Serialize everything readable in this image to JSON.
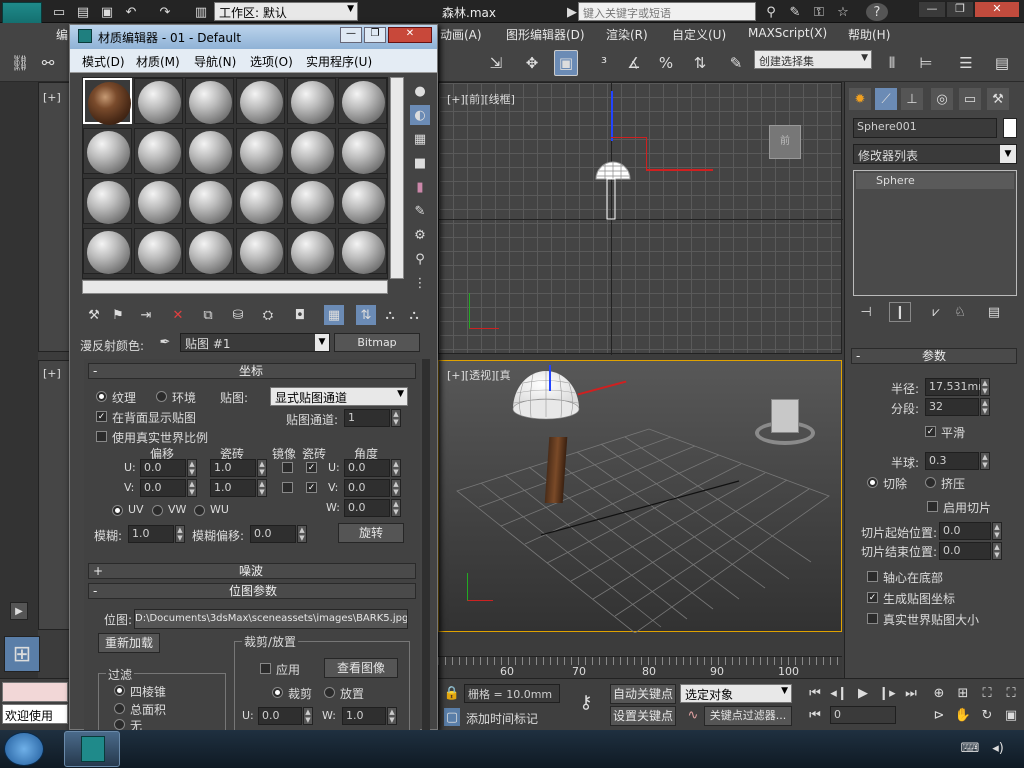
{
  "app": {
    "workspace_label": "工作区: 默认",
    "file_title": "森林.max",
    "search_placeholder": "键入关键字或短语"
  },
  "menu": [
    "编",
    "动画(A)",
    "图形编辑器(D)",
    "渲染(R)",
    "自定义(U)",
    "MAXScript(X)",
    "帮助(H)"
  ],
  "toolbar": {
    "selection_set": "创建选择集"
  },
  "viewports": {
    "front_label": "[+][前][线框]",
    "persp_label": "[+][透视][真",
    "topleft_label": "[+]",
    "midleft_label": "[+]"
  },
  "timeline": {
    "ticks": [
      "60",
      "70",
      "80",
      "90",
      "100"
    ]
  },
  "command_panel": {
    "object_name": "Sphere001",
    "modifier_list": "修改器列表",
    "stack_item": "Sphere",
    "params_title": "参数",
    "radius_label": "半径:",
    "radius_value": "17.531mm",
    "segments_label": "分段:",
    "segments_value": "32",
    "smooth_label": "平滑",
    "hemisphere_label": "半球:",
    "hemisphere_value": "0.3",
    "chop_label": "切除",
    "squash_label": "挤压",
    "slice_on_label": "启用切片",
    "slice_from_label": "切片起始位置:",
    "slice_from_value": "0.0",
    "slice_to_label": "切片结束位置:",
    "slice_to_value": "0.0",
    "base_pivot_label": "轴心在底部",
    "gen_map_label": "生成贴图坐标",
    "real_world_label": "真实世界贴图大小"
  },
  "material_editor": {
    "title": "材质编辑器 - 01 - Default",
    "menu": [
      "模式(D)",
      "材质(M)",
      "导航(N)",
      "选项(O)",
      "实用程序(U)"
    ],
    "diffuse_label": "漫反射颜色:",
    "map_name": "贴图 #1",
    "map_type": "Bitmap",
    "coords_title": "坐标",
    "texture_label": "纹理",
    "environ_label": "环境",
    "mapping_label": "贴图:",
    "mapping_value": "显式贴图通道",
    "show_back_label": "在背面显示贴图",
    "map_channel_label": "贴图通道:",
    "map_channel_value": "1",
    "real_world_label": "使用真实世界比例",
    "offset_header": "偏移",
    "tiling_header": "瓷砖",
    "mirror_header": "镜像",
    "tile_header": "瓷砖",
    "angle_header": "角度",
    "u_label": "U:",
    "v_label": "V:",
    "w_label": "W:",
    "u_offset": "0.0",
    "v_offset": "0.0",
    "u_tiling": "1.0",
    "v_tiling": "1.0",
    "u_angle": "0.0",
    "v_angle": "0.0",
    "w_angle": "0.0",
    "uv_label": "UV",
    "vw_label": "VW",
    "wu_label": "WU",
    "blur_label": "模糊:",
    "blur_value": "1.0",
    "blur_offset_label": "模糊偏移:",
    "blur_offset_value": "0.0",
    "rotate_button": "旋转",
    "noise_title": "噪波",
    "bitmap_params_title": "位图参数",
    "bitmap_label": "位图:",
    "bitmap_path": "D:\\Documents\\3dsMax\\sceneassets\\images\\BARK5.jpg",
    "reload_button": "重新加载",
    "crop_group": "裁剪/放置",
    "apply_label": "应用",
    "view_image_button": "查看图像",
    "crop_label": "裁剪",
    "place_label": "放置",
    "filter_group": "过滤",
    "pyramidal_label": "四棱锥",
    "summed_label": "总面积",
    "none_label": "无",
    "crop_u_label": "U:",
    "crop_u_value": "0.0",
    "crop_w_label": "W:",
    "crop_w_value": "1.0"
  },
  "status": {
    "welcome": "欢迎使用",
    "grid_label": "栅格 = 10.0mm",
    "auto_key": "自动关键点",
    "set_key": "设置关键点",
    "selected_object": "选定对象",
    "key_filters": "关键点过滤器...",
    "add_time_tag": "添加时间标记",
    "frame_value": "0"
  }
}
